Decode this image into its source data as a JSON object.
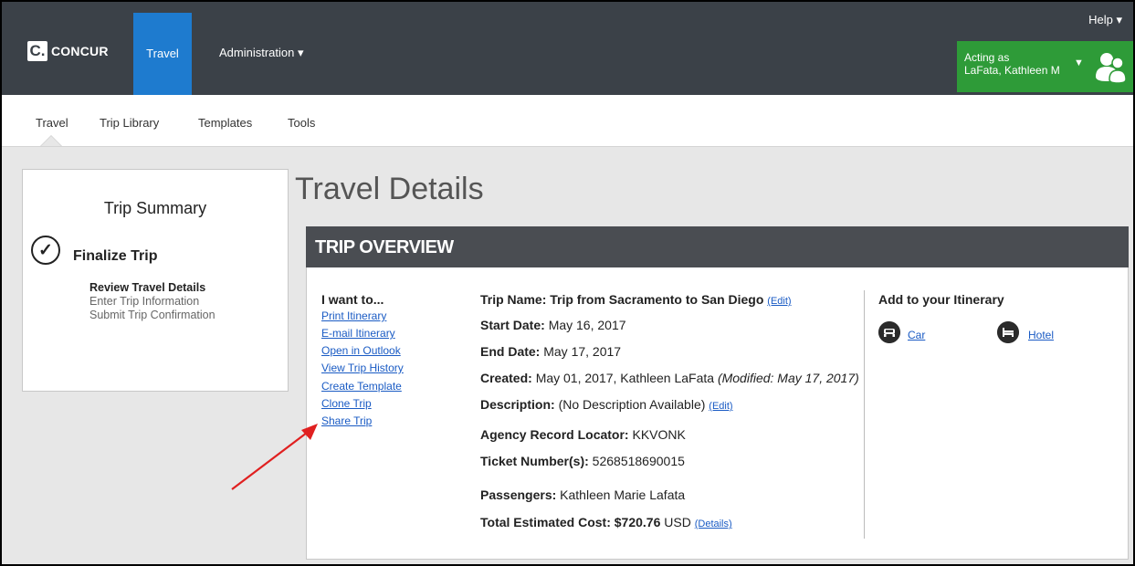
{
  "header": {
    "logo_mark": "C.",
    "logo_text": "CONCUR",
    "active_tab": "Travel",
    "admin_menu": "Administration ▾",
    "help": "Help ▾",
    "acting_label": "Acting as",
    "acting_user": "LaFata, Kathleen M",
    "acting_caret": "▼"
  },
  "subnav": {
    "items": [
      "Travel",
      "Trip Library",
      "Templates",
      "Tools"
    ]
  },
  "summary": {
    "title": "Trip Summary",
    "check": "✓",
    "step": "Finalize Trip",
    "substeps": [
      "Review Travel Details",
      "Enter Trip Information",
      "Submit Trip Confirmation"
    ]
  },
  "page_title": "Travel Details",
  "overview": {
    "heading": "TRIP OVERVIEW",
    "i_want_to": "I want to...",
    "actions": [
      "Print Itinerary",
      "E-mail Itinerary",
      "Open in Outlook",
      "View Trip History",
      "Create Template",
      "Clone Trip",
      "Share Trip"
    ],
    "details": {
      "trip_name_label": "Trip Name:",
      "trip_name": "Trip from Sacramento to San Diego",
      "edit": "(Edit)",
      "start_label": "Start Date:",
      "start": "May 16, 2017",
      "end_label": "End Date:",
      "end": "May 17, 2017",
      "created_label": "Created:",
      "created": "May 01, 2017, Kathleen LaFata",
      "modified": "(Modified: May 17, 2017)",
      "desc_label": "Description:",
      "desc": "(No Description Available)",
      "locator_label": "Agency Record Locator:",
      "locator": "KKVONK",
      "ticket_label": "Ticket Number(s):",
      "ticket": "5268518690015",
      "passengers_label": "Passengers:",
      "passengers": "Kathleen Marie Lafata",
      "cost_label": "Total Estimated Cost:",
      "cost": "$720.76",
      "currency": "USD",
      "details_link": "(Details)"
    },
    "add_title": "Add to your Itinerary",
    "add_car": "Car",
    "add_hotel": "Hotel"
  },
  "annotation_color": "#e02020"
}
